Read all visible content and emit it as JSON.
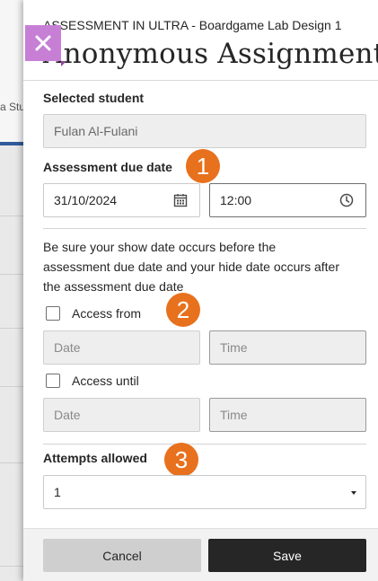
{
  "background": {
    "tab_text": "a Stu"
  },
  "panel": {
    "course_label": "ASSESSMENT IN ULTRA - Boardgame Lab Design 1",
    "title": "Anonymous Assignment"
  },
  "form": {
    "selected_student": {
      "label": "Selected student",
      "value": "Fulan Al-Fulani"
    },
    "due_date": {
      "label": "Assessment due date",
      "date_value": "31/10/2024",
      "time_value": "12:00"
    },
    "help_text": "Be sure your show date occurs before the assessment due date and your hide date occurs after the assessment due date",
    "access_from": {
      "label": "Access from",
      "date_placeholder": "Date",
      "time_placeholder": "Time"
    },
    "access_until": {
      "label": "Access until",
      "date_placeholder": "Date",
      "time_placeholder": "Time"
    },
    "attempts": {
      "label": "Attempts allowed",
      "value": "1"
    }
  },
  "badges": [
    "1",
    "2",
    "3"
  ],
  "footer": {
    "cancel_label": "Cancel",
    "save_label": "Save"
  },
  "colors": {
    "close_button": "#c77fd6",
    "badge": "#e8711e",
    "save_button": "#262626",
    "tab_underline": "#2f5b9c"
  },
  "icons": {
    "close": "close-icon",
    "calendar": "calendar-icon",
    "clock": "clock-icon",
    "caret": "caret-down-icon"
  }
}
